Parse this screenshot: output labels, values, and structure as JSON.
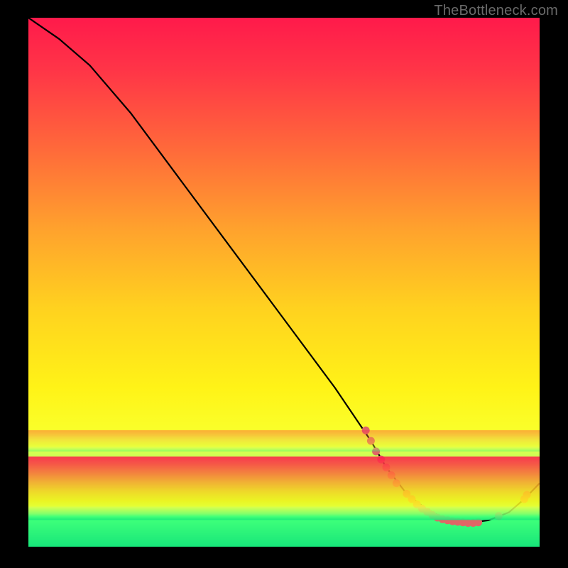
{
  "watermark": "TheBottleneck.com",
  "chart_data": {
    "type": "line",
    "title": "",
    "xlabel": "",
    "ylabel": "",
    "xlim": [
      0,
      100
    ],
    "ylim": [
      0,
      100
    ],
    "series": [
      {
        "name": "bottleneck-curve",
        "x": [
          0,
          6,
          12,
          20,
          30,
          40,
          50,
          60,
          67,
          70,
          74,
          78,
          82,
          86,
          90,
          94,
          97,
          100
        ],
        "y": [
          100,
          96,
          91,
          82,
          69,
          56,
          43,
          30,
          20,
          15,
          10,
          7,
          5,
          4.5,
          5,
          6.5,
          9,
          12
        ]
      }
    ],
    "emphasis_points": {
      "name": "highlight-cluster",
      "color": "#e06666",
      "x": [
        66,
        67,
        68,
        69,
        70,
        71,
        72,
        74,
        75,
        76,
        77,
        78,
        79,
        80,
        81,
        82,
        83,
        84,
        85,
        86,
        87,
        88,
        92,
        97,
        97.5
      ],
      "y": [
        22,
        20,
        18,
        16.5,
        15,
        13.5,
        12,
        10,
        9,
        8,
        7.2,
        6.6,
        6,
        5.5,
        5.2,
        5,
        4.8,
        4.7,
        4.6,
        4.5,
        4.5,
        4.6,
        5.8,
        9,
        9.8
      ]
    },
    "gradient_stops": [
      {
        "offset": 0.0,
        "color": "#ff1a4b"
      },
      {
        "offset": 0.1,
        "color": "#ff3547"
      },
      {
        "offset": 0.25,
        "color": "#ff6a3a"
      },
      {
        "offset": 0.4,
        "color": "#ffa22d"
      },
      {
        "offset": 0.55,
        "color": "#ffd21f"
      },
      {
        "offset": 0.7,
        "color": "#fff317"
      },
      {
        "offset": 0.78,
        "color": "#faff2a"
      },
      {
        "offset": 0.8,
        "color": "#e8ff4a"
      },
      {
        "offset": 0.9,
        "color": "#8eff6a"
      },
      {
        "offset": 0.95,
        "color": "#3dff7a"
      },
      {
        "offset": 1.0,
        "color": "#17e67a"
      }
    ],
    "legend_bands": [
      {
        "top_frac": 0.78,
        "height_frac": 0.04,
        "alpha": 0.35
      },
      {
        "top_frac": 0.83,
        "height_frac": 0.12,
        "alpha": 0.85
      }
    ]
  }
}
